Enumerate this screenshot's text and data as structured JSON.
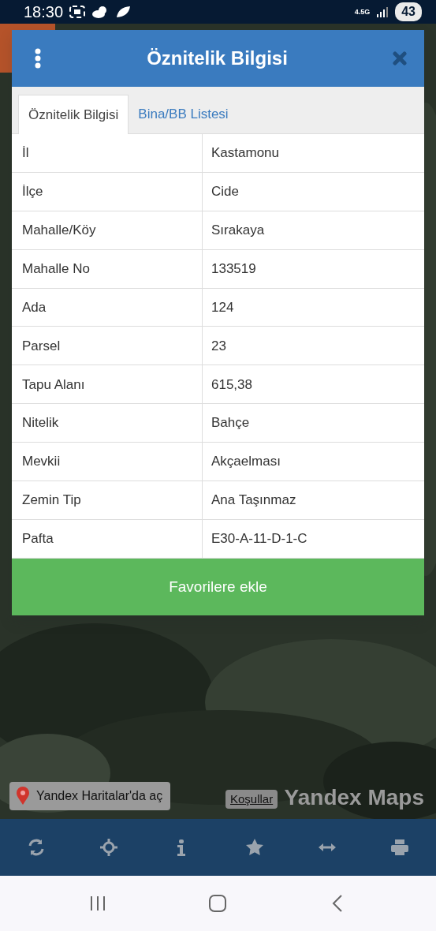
{
  "status_bar": {
    "time": "18:30",
    "network": "4.5G",
    "battery": "43"
  },
  "dialog": {
    "title": "Öznitelik Bilgisi",
    "tabs": [
      {
        "label": "Öznitelik Bilgisi",
        "selected": true
      },
      {
        "label": "Bina/BB Listesi",
        "selected": false
      }
    ],
    "rows": [
      {
        "label": "İl",
        "value": "Kastamonu"
      },
      {
        "label": "İlçe",
        "value": "Cide"
      },
      {
        "label": "Mahalle/Köy",
        "value": "Sırakaya"
      },
      {
        "label": "Mahalle No",
        "value": "133519"
      },
      {
        "label": "Ada",
        "value": "124"
      },
      {
        "label": "Parsel",
        "value": "23"
      },
      {
        "label": "Tapu Alanı",
        "value": "615,38"
      },
      {
        "label": "Nitelik",
        "value": "Bahçe"
      },
      {
        "label": "Mevkii",
        "value": "Akçaelması"
      },
      {
        "label": "Zemin Tip",
        "value": "Ana Taşınmaz"
      },
      {
        "label": "Pafta",
        "value": "E30-A-11-D-1-C"
      }
    ],
    "button": "Favorilere ekle"
  },
  "map": {
    "open_link": "Yandex Haritalar'da aç",
    "terms_link": "Koşullar",
    "logo": "Yandex Maps"
  },
  "toolbar": [
    {
      "kind": "refresh"
    },
    {
      "kind": "locate"
    },
    {
      "kind": "info"
    },
    {
      "kind": "star"
    },
    {
      "kind": "measure"
    },
    {
      "kind": "print"
    }
  ],
  "nav_bar": [
    {
      "kind": "recents"
    },
    {
      "kind": "home"
    },
    {
      "kind": "back"
    }
  ]
}
